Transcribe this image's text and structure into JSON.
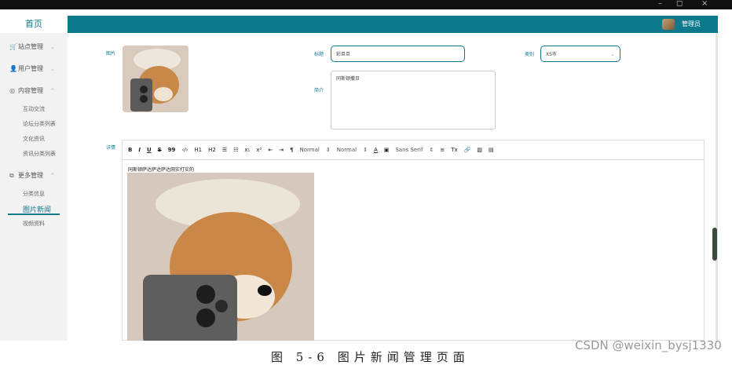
{
  "window": {
    "min": "–",
    "max": "◻",
    "close": "×"
  },
  "app": {
    "home_label": "首页",
    "admin_name": "管理员"
  },
  "sidebar": {
    "sections": [
      {
        "icon": "cart-icon",
        "label": "站点管理",
        "chev": "⌄"
      },
      {
        "icon": "user-icon",
        "label": "用户管理",
        "chev": "⌄"
      },
      {
        "icon": "chat-icon",
        "label": "内容管理",
        "chev": "^"
      },
      {
        "icon": "copy-icon",
        "label": "更多管理",
        "chev": "^"
      }
    ],
    "content_items": [
      "互动交流",
      "论坛分类列表",
      "文化资讯",
      "资讯分类列表"
    ],
    "more_items": [
      "分类信息",
      "图片新闻",
      "视频资料"
    ]
  },
  "form": {
    "image_label": "图片",
    "title_label": "标题",
    "title_value": "彩旦旦",
    "category_label": "类别",
    "category_value": "XS市",
    "summary_label": "简介",
    "summary_value": "同斯顿撒旦",
    "detail_label": "详情",
    "editor_text": "同斯顿萨达萨达萨达网实打实的"
  },
  "toolbar": {
    "bold": "B",
    "italic": "I",
    "underline": "U",
    "strike": "S",
    "quote": "99",
    "code": "‹/›",
    "h1": "H1",
    "h2": "H2",
    "list_ol": "☰",
    "list_ul": "☷",
    "sub": "x₁",
    "sup": "x²",
    "indent_l": "⇤",
    "indent_r": "⇥",
    "para": "¶",
    "normal1": "Normal",
    "normal2": "Normal",
    "font_color": "A",
    "bg_color": "▣",
    "font": "Sans Serif",
    "align": "≡",
    "clear": "Tx",
    "link": "🔗",
    "image": "▨",
    "video": "▤"
  },
  "watermark": "CSDN @weixin_bysj1330",
  "caption": "图 5-6 图片新闻管理页面",
  "colors": {
    "accent": "#0d7a8c"
  }
}
